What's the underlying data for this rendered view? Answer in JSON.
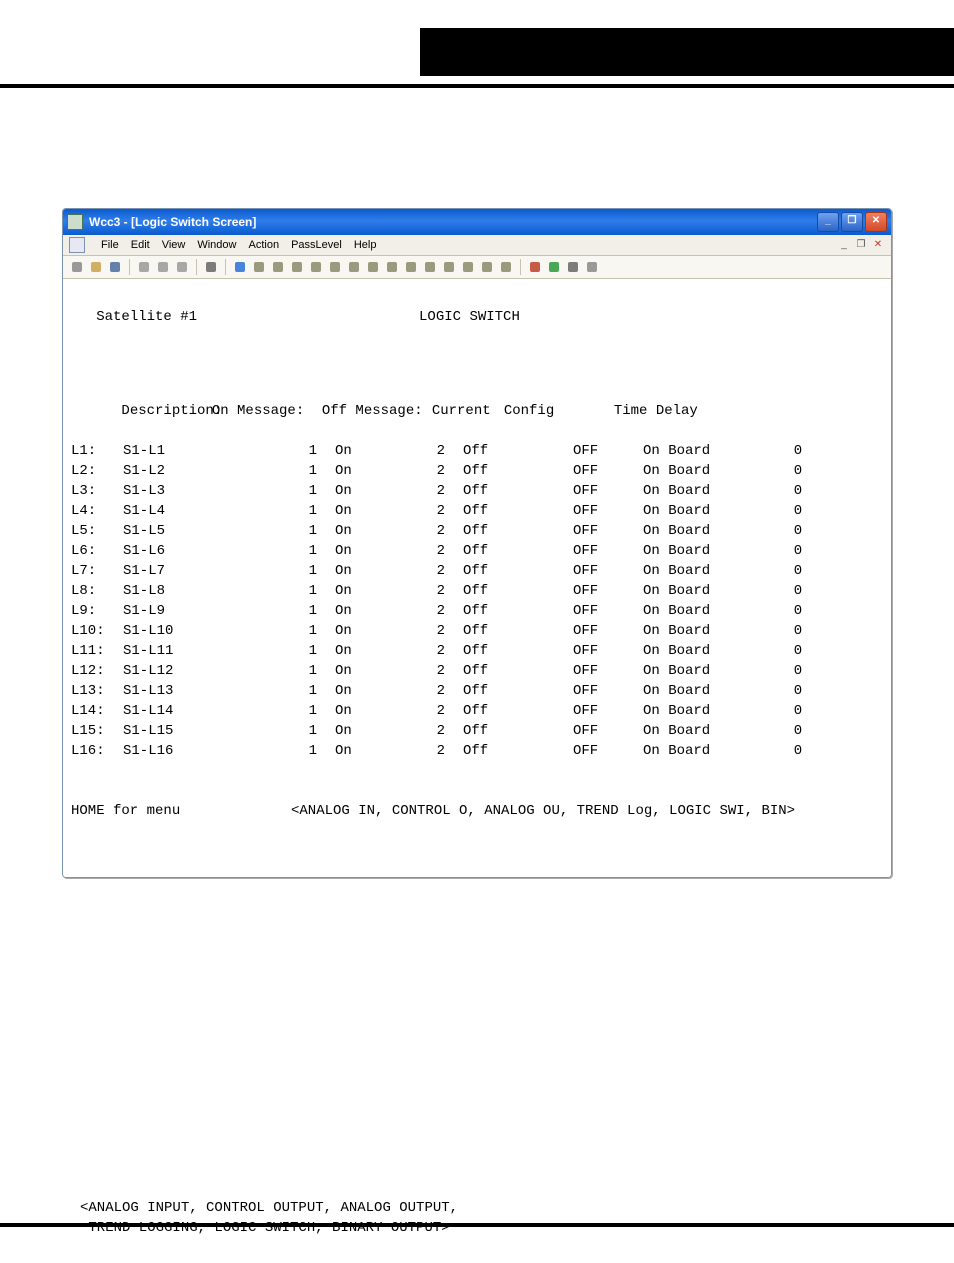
{
  "window": {
    "title": "Wcc3 - [Logic Switch Screen]",
    "minimize_label": "_",
    "maximize_label": "❐",
    "close_label": "✕",
    "child_min": "_",
    "child_max": "❐",
    "child_close": "✕"
  },
  "menus": [
    "File",
    "Edit",
    "View",
    "Window",
    "Action",
    "PassLevel",
    "Help"
  ],
  "header": {
    "satellite": "Satellite #1",
    "screen_title": "LOGIC SWITCH",
    "col_description": "Description:",
    "col_on_message": "On Message:",
    "col_off_message": "Off Message:",
    "col_current": "Current",
    "col_config": "Config",
    "col_time_delay": "Time Delay"
  },
  "rows": [
    {
      "label": "L1:",
      "desc": "S1-L1",
      "onk": "1",
      "onv": "On",
      "offk": "2",
      "offv": "Off",
      "cur": "OFF",
      "cfg": "On Board",
      "td": "0"
    },
    {
      "label": "L2:",
      "desc": "S1-L2",
      "onk": "1",
      "onv": "On",
      "offk": "2",
      "offv": "Off",
      "cur": "OFF",
      "cfg": "On Board",
      "td": "0"
    },
    {
      "label": "L3:",
      "desc": "S1-L3",
      "onk": "1",
      "onv": "On",
      "offk": "2",
      "offv": "Off",
      "cur": "OFF",
      "cfg": "On Board",
      "td": "0"
    },
    {
      "label": "L4:",
      "desc": "S1-L4",
      "onk": "1",
      "onv": "On",
      "offk": "2",
      "offv": "Off",
      "cur": "OFF",
      "cfg": "On Board",
      "td": "0"
    },
    {
      "label": "L5:",
      "desc": "S1-L5",
      "onk": "1",
      "onv": "On",
      "offk": "2",
      "offv": "Off",
      "cur": "OFF",
      "cfg": "On Board",
      "td": "0"
    },
    {
      "label": "L6:",
      "desc": "S1-L6",
      "onk": "1",
      "onv": "On",
      "offk": "2",
      "offv": "Off",
      "cur": "OFF",
      "cfg": "On Board",
      "td": "0"
    },
    {
      "label": "L7:",
      "desc": "S1-L7",
      "onk": "1",
      "onv": "On",
      "offk": "2",
      "offv": "Off",
      "cur": "OFF",
      "cfg": "On Board",
      "td": "0"
    },
    {
      "label": "L8:",
      "desc": "S1-L8",
      "onk": "1",
      "onv": "On",
      "offk": "2",
      "offv": "Off",
      "cur": "OFF",
      "cfg": "On Board",
      "td": "0"
    },
    {
      "label": "L9:",
      "desc": "S1-L9",
      "onk": "1",
      "onv": "On",
      "offk": "2",
      "offv": "Off",
      "cur": "OFF",
      "cfg": "On Board",
      "td": "0"
    },
    {
      "label": "L10:",
      "desc": "S1-L10",
      "onk": "1",
      "onv": "On",
      "offk": "2",
      "offv": "Off",
      "cur": "OFF",
      "cfg": "On Board",
      "td": "0"
    },
    {
      "label": "L11:",
      "desc": "S1-L11",
      "onk": "1",
      "onv": "On",
      "offk": "2",
      "offv": "Off",
      "cur": "OFF",
      "cfg": "On Board",
      "td": "0"
    },
    {
      "label": "L12:",
      "desc": "S1-L12",
      "onk": "1",
      "onv": "On",
      "offk": "2",
      "offv": "Off",
      "cur": "OFF",
      "cfg": "On Board",
      "td": "0"
    },
    {
      "label": "L13:",
      "desc": "S1-L13",
      "onk": "1",
      "onv": "On",
      "offk": "2",
      "offv": "Off",
      "cur": "OFF",
      "cfg": "On Board",
      "td": "0"
    },
    {
      "label": "L14:",
      "desc": "S1-L14",
      "onk": "1",
      "onv": "On",
      "offk": "2",
      "offv": "Off",
      "cur": "OFF",
      "cfg": "On Board",
      "td": "0"
    },
    {
      "label": "L15:",
      "desc": "S1-L15",
      "onk": "1",
      "onv": "On",
      "offk": "2",
      "offv": "Off",
      "cur": "OFF",
      "cfg": "On Board",
      "td": "0"
    },
    {
      "label": "L16:",
      "desc": "S1-L16",
      "onk": "1",
      "onv": "On",
      "offk": "2",
      "offv": "Off",
      "cur": "OFF",
      "cfg": "On Board",
      "td": "0"
    }
  ],
  "footer": {
    "home": "HOME for menu",
    "nav": "<ANALOG IN, CONTROL O, ANALOG OU, TREND Log, LOGIC SWI, BIN>"
  },
  "below": {
    "line1": "<ANALOG INPUT, CONTROL OUTPUT, ANALOG OUTPUT,",
    "line2": " TREND LOGGING, LOGIC SWITCH, BINARY OUTPUT>"
  },
  "toolbar_icons": [
    "new-icon",
    "open-icon",
    "save-icon",
    "sep",
    "cut-icon",
    "copy-icon",
    "paste-icon",
    "sep",
    "print-icon",
    "sep",
    "help-icon",
    "tool-a-icon",
    "tool-b-icon",
    "tool-c-icon",
    "tool-d-icon",
    "tool-e-icon",
    "tool-f-icon",
    "tool-g-icon",
    "tool-h-icon",
    "star-icon",
    "wand-icon",
    "spark-icon",
    "bolt-icon",
    "graph-icon",
    "chart-icon",
    "sep",
    "square-red-icon",
    "dot-green-icon",
    "gear-icon",
    "stack-icon"
  ]
}
